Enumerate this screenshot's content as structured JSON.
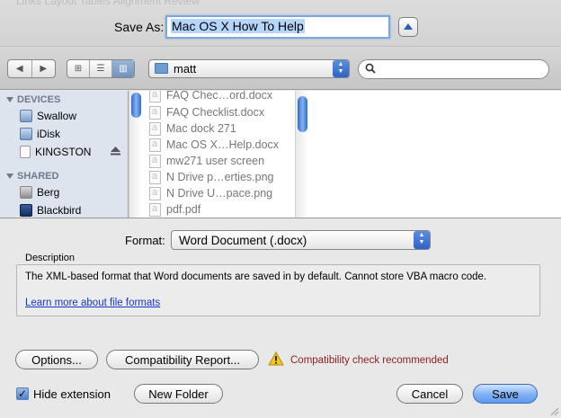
{
  "top": {
    "ghost_text": "Links    Layout    Tables    Alignment    Review",
    "save_as_label": "Save As:",
    "file_name": "Mac OS X How To Help"
  },
  "toolbar": {
    "nav_back": "◀",
    "nav_forward": "▶",
    "view_icon": "⊞",
    "view_list": "☰",
    "view_columns": "▥",
    "folder_name": "matt",
    "search_placeholder": ""
  },
  "sidebar": {
    "devices_heading": "DEVICES",
    "shared_heading": "SHARED",
    "devices": [
      {
        "label": "Swallow",
        "icon": "hard-disk-icon"
      },
      {
        "label": "iDisk",
        "icon": "idisk-icon"
      },
      {
        "label": "KINGSTON",
        "icon": "usb-drive-icon"
      }
    ],
    "shared": [
      {
        "label": "Berg",
        "icon": "computer-icon"
      },
      {
        "label": "Blackbird",
        "icon": "display-icon"
      }
    ]
  },
  "files": [
    "FAQ Chec…ord.docx",
    "FAQ Checklist.docx",
    "Mac dock 271",
    "Mac OS X…Help.docx",
    "mw271 user screen",
    "N Drive p…erties.png",
    "N Drive U…pace.png",
    "pdf.pdf"
  ],
  "format": {
    "label": "Format:",
    "value": "Word Document (.docx)"
  },
  "description": {
    "label": "Description",
    "text": "The XML-based format that Word documents are saved in by default. Cannot store VBA macro code.",
    "link": "Learn more about file formats"
  },
  "buttons": {
    "options": "Options...",
    "compat_report": "Compatibility Report...",
    "new_folder": "New Folder",
    "cancel": "Cancel",
    "save": "Save"
  },
  "compat_status": "Compatibility check recommended",
  "hide_extension": {
    "label": "Hide extension",
    "checked": true,
    "mark": "✓"
  },
  "colors": {
    "accent": "#3875d7",
    "warning_text": "#8a1f1f",
    "link": "#1436c8"
  }
}
